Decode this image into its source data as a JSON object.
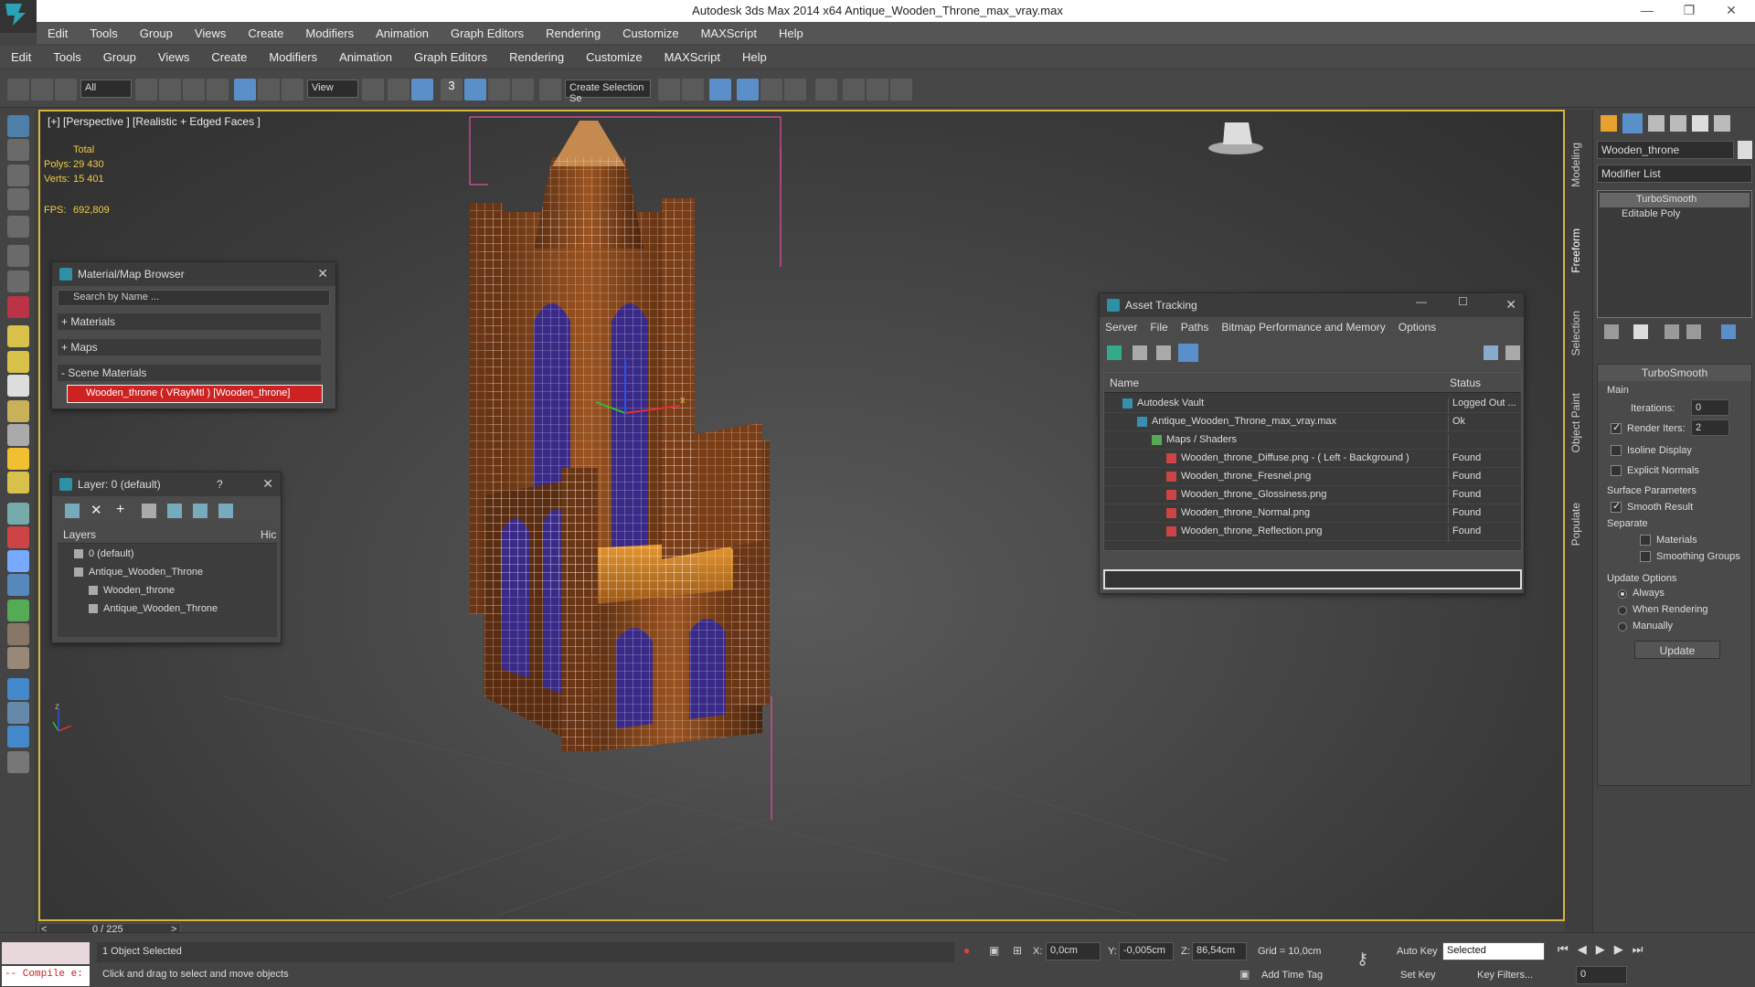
{
  "app": {
    "title": "Autodesk 3ds Max  2014 x64    Antique_Wooden_Throne_max_vray.max",
    "win_min": "—",
    "win_max": "❐",
    "win_close": "✕"
  },
  "menu1": [
    "Edit",
    "Tools",
    "Group",
    "Views",
    "Create",
    "Modifiers",
    "Animation",
    "Graph Editors",
    "Rendering",
    "Customize",
    "MAXScript",
    "Help"
  ],
  "menu2": [
    "Edit",
    "Tools",
    "Group",
    "Views",
    "Create",
    "Modifiers",
    "Animation",
    "Graph Editors",
    "Rendering",
    "Customize",
    "MAXScript",
    "Help"
  ],
  "toolbar": {
    "selection_filter": "All",
    "ref_coord": "View",
    "snap_3": "3",
    "named_selection_placeholder": "Create Selection Se"
  },
  "viewport": {
    "label": "[+] [Perspective ] [Realistic + Edged Faces ]",
    "stats_total": "Total",
    "polys_label": "Polys:",
    "polys_value": "29 430",
    "verts_label": "Verts:",
    "verts_value": "15 401",
    "fps_label": "FPS:",
    "fps_value": "692,809",
    "axis_x": "x",
    "axis_y": "y",
    "axis_z": "z"
  },
  "material_browser": {
    "title": "Material/Map Browser",
    "search_placeholder": "Search by Name ...",
    "groups": [
      "+ Materials",
      "+ Maps",
      "- Scene Materials"
    ],
    "selected_item": "Wooden_throne  ( VRayMtl ) [Wooden_throne]"
  },
  "layer_panel": {
    "title": "Layer: 0 (default)",
    "help": "?",
    "col_layers": "Layers",
    "col_hide": "Hic",
    "rows": [
      {
        "name": "0 (default)",
        "indent": 0
      },
      {
        "name": "Antique_Wooden_Throne",
        "indent": 0
      },
      {
        "name": "Wooden_throne",
        "indent": 1
      },
      {
        "name": "Antique_Wooden_Throne",
        "indent": 1
      }
    ]
  },
  "asset_tracking": {
    "title": "Asset Tracking",
    "menus": [
      "Server",
      "File",
      "Paths",
      "Bitmap Performance and Memory",
      "Options"
    ],
    "col_name": "Name",
    "col_status": "Status",
    "rows": [
      {
        "name": "Autodesk Vault",
        "status": "Logged Out ...",
        "indent": 0
      },
      {
        "name": "Antique_Wooden_Throne_max_vray.max",
        "status": "Ok",
        "indent": 1
      },
      {
        "name": "Maps / Shaders",
        "status": "",
        "indent": 2
      },
      {
        "name": "Wooden_throne_Diffuse.png -  ( Left - Background )",
        "status": "Found",
        "indent": 3
      },
      {
        "name": "Wooden_throne_Fresnel.png",
        "status": "Found",
        "indent": 3
      },
      {
        "name": "Wooden_throne_Glossiness.png",
        "status": "Found",
        "indent": 3
      },
      {
        "name": "Wooden_throne_Normal.png",
        "status": "Found",
        "indent": 3
      },
      {
        "name": "Wooden_throne_Reflection.png",
        "status": "Found",
        "indent": 3
      }
    ]
  },
  "side_tabs": [
    "Modeling",
    "Freeform",
    "Selection",
    "Object Paint",
    "Populate"
  ],
  "command_panel": {
    "object_name": "Wooden_throne",
    "modifier_list": "Modifier List",
    "stack": [
      "TurboSmooth",
      "Editable Poly"
    ],
    "rollout_title": "TurboSmooth",
    "main_group": "Main",
    "iterations_label": "Iterations:",
    "iterations_value": "0",
    "render_iters_label": "Render Iters:",
    "render_iters_value": "2",
    "isoline": "Isoline Display",
    "explicit_normals": "Explicit Normals",
    "surface_params": "Surface Parameters",
    "smooth_result": "Smooth Result",
    "separate": "Separate",
    "materials": "Materials",
    "smoothing_groups": "Smoothing Groups",
    "update_options": "Update Options",
    "always": "Always",
    "when_rendering": "When Rendering",
    "manually": "Manually",
    "update_button": "Update"
  },
  "timeline": {
    "frame": "0 / 225",
    "prev": "<",
    "next": ">"
  },
  "status": {
    "compile": "-- Compile e:",
    "selected": "1 Object Selected",
    "hint": "Click and drag to select and move objects",
    "x_label": "X:",
    "x_value": "0,0cm",
    "y_label": "Y:",
    "y_value": "-0,005cm",
    "z_label": "Z:",
    "z_value": "86,54cm",
    "grid": "Grid = 10,0cm",
    "add_time_tag": "Add Time Tag",
    "auto_key": "Auto Key",
    "set_key": "Set Key",
    "selected_dropdown": "Selected",
    "key_filters": "Key Filters...",
    "frame_field": "0"
  },
  "colors": {
    "accent": "#5b8fc9",
    "viewport_border": "#d8b53a",
    "stats": "#eecc44",
    "highlight_red": "#cc2222"
  }
}
